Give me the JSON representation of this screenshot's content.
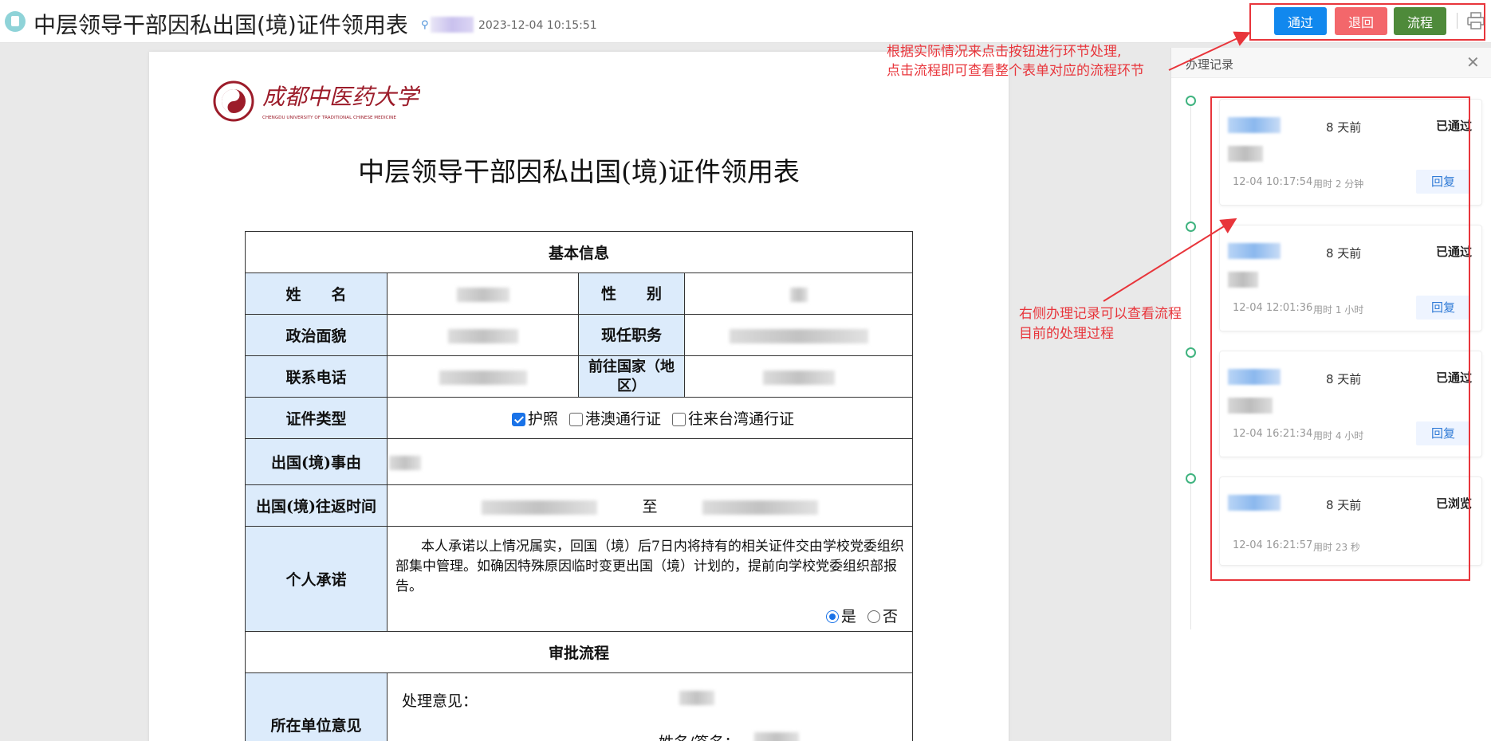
{
  "header": {
    "title": "中层领导干部因私出国(境)证件领用表",
    "timestamp": "2023-12-04 10:15:51",
    "buttons": {
      "pass": "通过",
      "back": "退回",
      "flow": "流程"
    }
  },
  "document": {
    "university_name": "成都中医药大学",
    "university_name_en": "CHENGDU UNIVERSITY OF TRADITIONAL CHINESE MEDICINE",
    "title": "中层领导干部因私出国(境)证件领用表",
    "section_basic": "基本信息",
    "labels": {
      "name": "姓　　名",
      "gender": "性　　别",
      "political": "政治面貌",
      "position": "现任职务",
      "phone": "联系电话",
      "destination": "前往国家（地区）",
      "cert_type": "证件类型",
      "reason": "出国(境)事由",
      "period": "出国(境)往返时间",
      "promise": "个人承诺"
    },
    "cert_options": [
      "护照",
      "港澳通行证",
      "往来台湾通行证"
    ],
    "cert_checked": [
      true,
      false,
      false
    ],
    "period_sep": "至",
    "promise_text": "本人承诺以上情况属实，回国（境）后7日内将持有的相关证件交由学校党委组织部集中管理。如确因特殊原因临时变更出国（境）计划的，提前向学校党委组织部报告。",
    "promise_yes": "是",
    "promise_no": "否",
    "section_approval": "审批流程",
    "unit_opinion_label": "所在单位意见",
    "opinion_prefix": "处理意见：",
    "sign_prefix": "姓名/签名："
  },
  "panel": {
    "title": "办理记录",
    "reply_label": "回复",
    "records": [
      {
        "ago": "8 天前",
        "status": "已通过",
        "time": "12-04 10:17:54",
        "duration": "用时 2 分钟",
        "has_reply": true
      },
      {
        "ago": "8 天前",
        "status": "已通过",
        "time": "12-04 12:01:36",
        "duration": "用时 1 小时",
        "has_reply": true
      },
      {
        "ago": "8 天前",
        "status": "已通过",
        "time": "12-04 16:21:34",
        "duration": "用时 4 小时",
        "has_reply": true
      },
      {
        "ago": "8 天前",
        "status": "已浏览",
        "time": "12-04 16:21:57",
        "duration": "用时 23 秒",
        "has_reply": false
      }
    ]
  },
  "annotations": {
    "top_line1": "根据实际情况来点击按钮进行环节处理,",
    "top_line2": "点击流程即可查看整个表单对应的流程环节",
    "mid_line1": "右侧办理记录可以查看流程",
    "mid_line2": "目前的处理过程"
  },
  "colors": {
    "pass": "#1188ee",
    "back": "#f3676b",
    "flow": "#4e8a3a",
    "annotation": "#e8353b",
    "label_bg": "#dcebfb"
  }
}
